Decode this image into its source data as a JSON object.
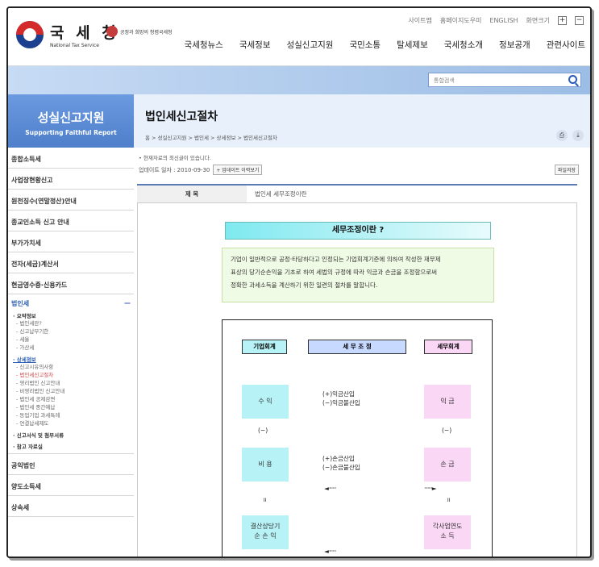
{
  "header": {
    "logo_kr": "국 세 청",
    "logo_en": "National Tax Service",
    "sub_logo_text": "공정과 희망의 청렴국세청",
    "util_links": [
      "사이트맵",
      "홈페이지도우미",
      "ENGLISH",
      "화면크기"
    ],
    "zoom_in": "+",
    "zoom_out": "−",
    "gnb": [
      "국세청뉴스",
      "국세정보",
      "성실신고지원",
      "국민소통",
      "탈세제보",
      "국세청소개",
      "정보공개",
      "관련사이트"
    ]
  },
  "search": {
    "placeholder": "통합검색"
  },
  "lnb": {
    "title": "성실신고지원",
    "subtitle": "Supporting Faithful Report",
    "items_top": [
      "종합소득세",
      "사업장현황신고",
      "원천징수(연말정산)안내",
      "종교인소득 신고 안내",
      "부가가치세",
      "전자(세금)계산서",
      "현금영수증·신용카드"
    ],
    "open_title": "법인세",
    "open_toggle": "—",
    "sec1": "· 요약정보",
    "sec1_items": [
      "- 법인세란?",
      "- 신고납부기한",
      "- 세율",
      "- 가산세"
    ],
    "sec2": "· 상세정보",
    "sec2_items": [
      "- 신고시유의사항",
      "- 법인세신고절차",
      "- 영리법인 신고안내",
      "- 비영리법인 신고안내",
      "- 법인세 공제감면",
      "- 법인세 중간예납",
      "- 동업기업 과세특례",
      "- 연결납세제도"
    ],
    "sec3": "· 신고서식 및 첨부서류",
    "sec4": "· 참고 자료실",
    "items_bottom": [
      "공익법인",
      "양도소득세",
      "상속세"
    ]
  },
  "content": {
    "title": "법인세신고절차",
    "breadcrumb": "홈 > 성실신고지원 > 법인세 > 상세정보 > 법인세신고절차",
    "print_icon": "⎙",
    "download_icon": "⤓",
    "notice": "• 현재자료의 최신글이 있습니다.",
    "updated": "업데이트 일자 : 2010-09-30",
    "history_btn": "+ 업데이트 이력보기",
    "save_btn": "파일저장",
    "subject_label": "제 목",
    "subject_value": "법인세 세무조정이란",
    "doc_title": "세무조정이란 ?",
    "doc_def_lines": [
      "기업이 일반적으로 공정·타당하다고 인정되는 기업회계기준에 의하여 작성한 재무제",
      "표상의 당기순손익을 기초로 하여 세법의 규정에 따라 익금과 손금을 조정함으로써",
      "정확한 과세소득을 계산하기 위한 일련의 절차를 말합니다."
    ],
    "diagram": {
      "col_left": "기업회계",
      "col_mid": "세 무 조 정",
      "col_right": "세무회계",
      "row1_left": "수 익",
      "row1_mid": [
        "(+)익금산입",
        "(−)익금불산입"
      ],
      "row1_right": "익 금",
      "minus": "(−)",
      "row2_left": "비 용",
      "row2_mid": [
        "(+)손금산입",
        "(−)손금불산입"
      ],
      "row2_right": "손 금",
      "equals": "॥",
      "row3_left": "결산상당기\n순 손 익",
      "row3_right": "각사업연도\n소   득",
      "colors": {
        "left_bg": "#b7f3f6",
        "mid_bg": "#c7d9ff",
        "right_bg": "#fbd7f6"
      }
    }
  }
}
